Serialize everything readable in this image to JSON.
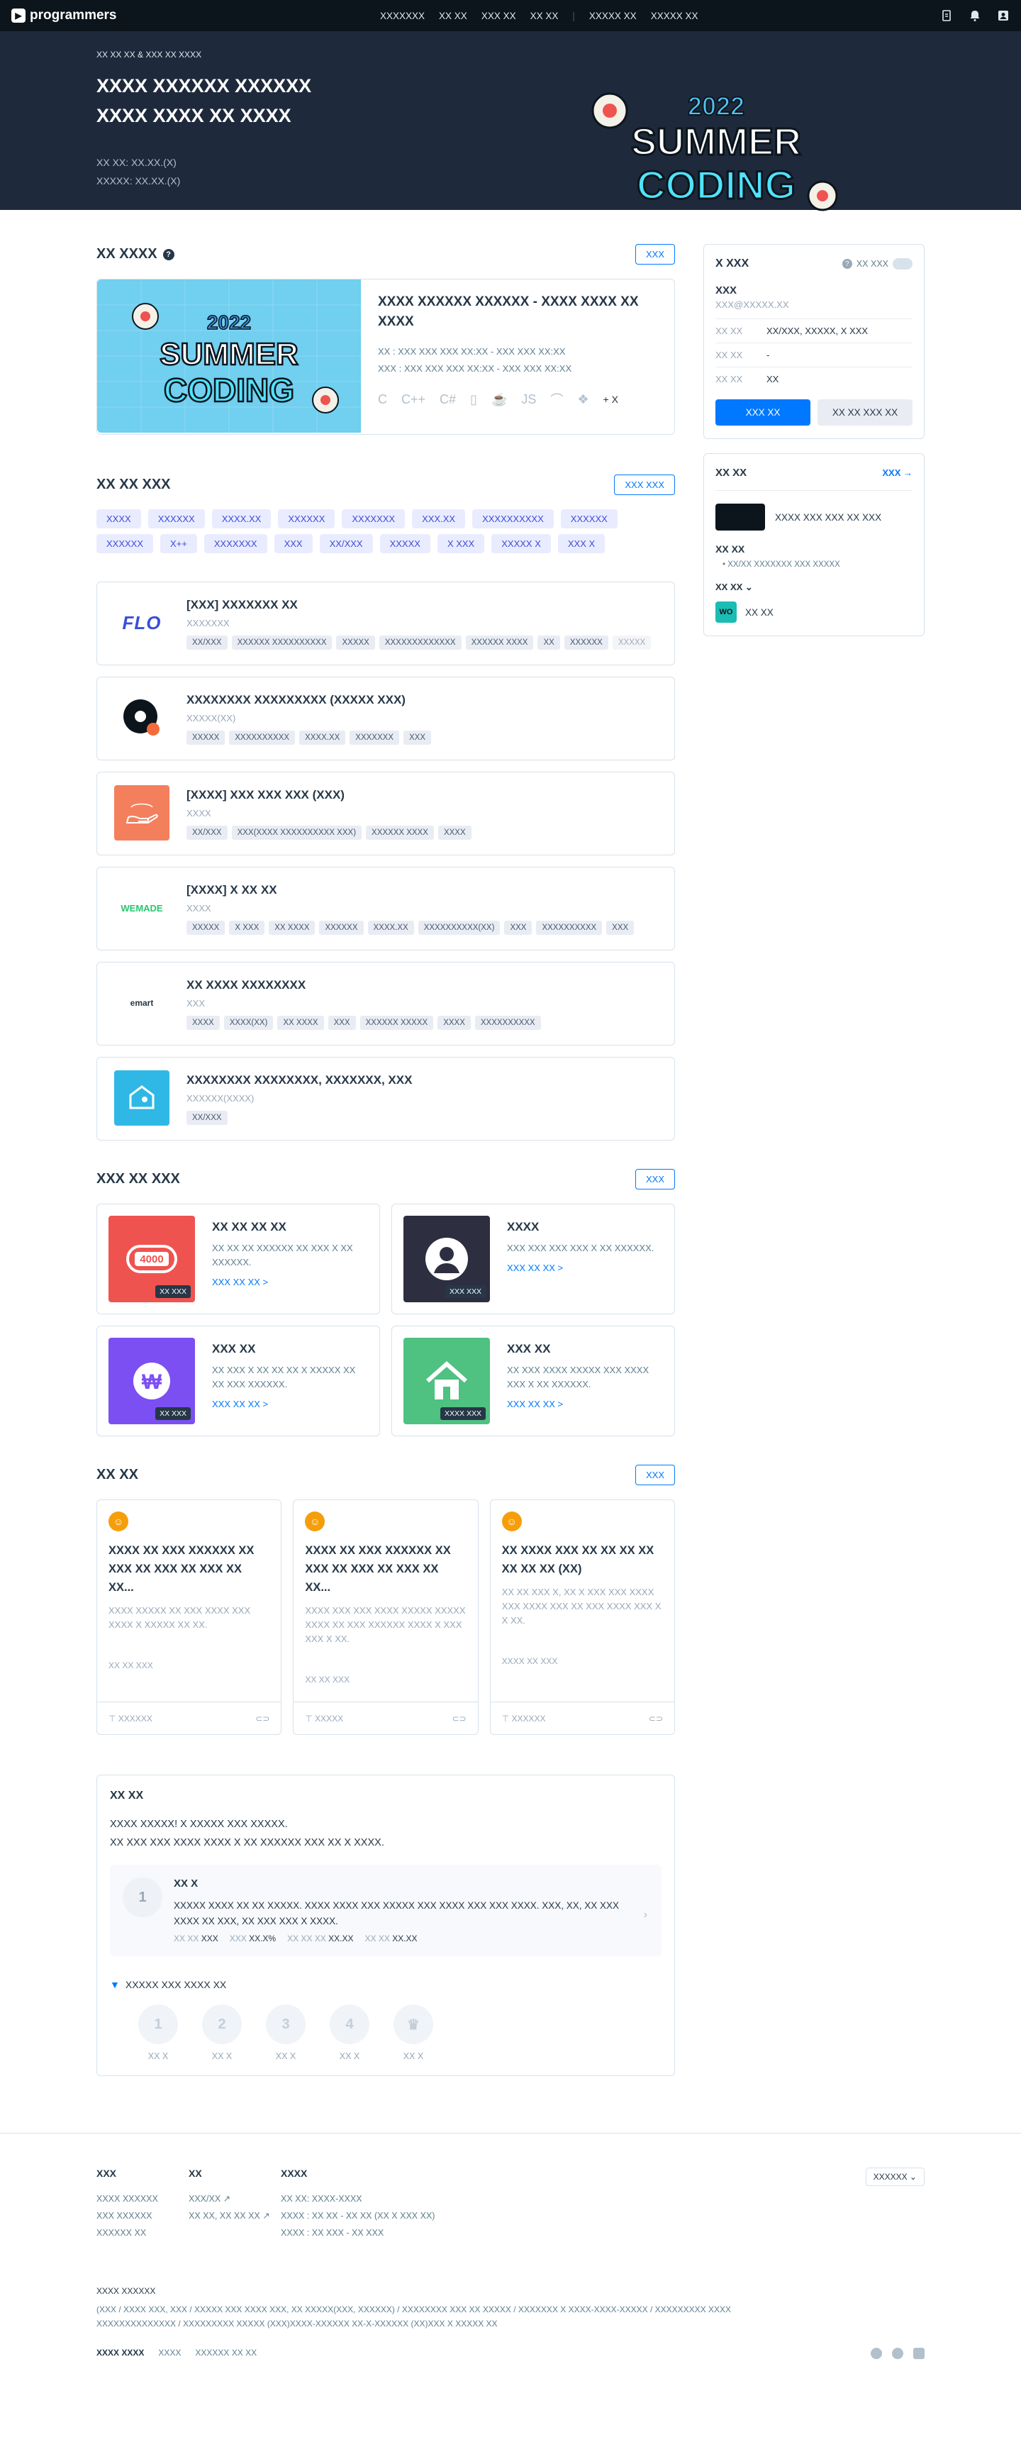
{
  "nav": {
    "brand": "programmers",
    "links": [
      "XXXXXXX",
      "XX XX",
      "XXX XX",
      "XX XX",
      "XXXXX XX",
      "XXXXX XX"
    ]
  },
  "hero": {
    "crumb": "XX XX XX & XXX XX XXXX",
    "title_line1": "XXXX XXXXXX XXXXXX",
    "title_line2": "XXXX XXXX XX XXXX",
    "meta_line1": "XX XX: XX.XX.(X)",
    "meta_line2": "XXXXX: XX.XX.(X)",
    "art_year": "2022",
    "art_word1": "SUMMER",
    "art_word2": "CODING"
  },
  "featured": {
    "section_title": "XX XXXX",
    "all_button": "XXX",
    "title": "XXXX XXXXXX XXXXXX - XXXX XXXX XX XXXX",
    "line1": "XX : XXX XXX XXX XX:XX - XXX XXX XX:XX",
    "line2": "XXX : XXX XXX XXX XX:XX - XXX XXX XX:XX",
    "langs": [
      "C",
      "C++",
      "C#",
      "▯",
      "☕",
      "JS",
      "⌒",
      "❖"
    ],
    "langs_more": "+ X"
  },
  "jobs": {
    "section_title": "XX XX XXX",
    "all_button": "XXX XXX",
    "tags": [
      "XXXX",
      "XXXXXX",
      "XXXX.XX",
      "XXXXXX",
      "XXXXXXX",
      "XXX.XX",
      "XXXXXXXXXX",
      "XXXXXX",
      "XXXXXX",
      "X++",
      "XXXXXXX",
      "XXX",
      "XX/XXX",
      "XXXXX",
      "X XXX",
      "XXXXX X",
      "XXX X"
    ],
    "items": [
      {
        "logo_text": "FLO",
        "title": "[XXX] XXXXXXX XX",
        "sub": "XXXXXXX",
        "chips": [
          "XX/XXX",
          "XXXXXX XXXXXXXXXX",
          "XXXXX",
          "XXXXXXXXXXXXX",
          "XXXXXX XXXX",
          "XX",
          "XXXXXX",
          "XXXXX"
        ]
      },
      {
        "logo_text": "",
        "title": "XXXXXXXX XXXXXXXXX (XXXXX XXX)",
        "sub": "XXXXX(XX)",
        "chips": [
          "XXXXX",
          "XXXXXXXXXX",
          "XXXX.XX",
          "XXXXXXX",
          "XXX"
        ]
      },
      {
        "logo_text": "",
        "title": "[XXXX] XXX XXX XXX (XXX)",
        "sub": "XXXX",
        "chips": [
          "XX/XXX",
          "XXX(XXXX XXXXXXXXXX XXX)",
          "XXXXXX XXXX",
          "XXXX"
        ]
      },
      {
        "logo_text": "WEMADE",
        "title": "[XXXX] X XX XX",
        "sub": "XXXX",
        "chips": [
          "XXXXX",
          "X XXX",
          "XX XXXX",
          "XXXXXX",
          "XXXX.XX",
          "XXXXXXXXXX(XX)",
          "XXX",
          "XXXXXXXXXX",
          "XXX"
        ]
      },
      {
        "logo_text": "emart",
        "title": "XX XXXX XXXXXXXX",
        "sub": "XXX",
        "chips": [
          "XXXX",
          "XXXX(XX)",
          "XX XXXX",
          "XXX",
          "XXXXXX XXXXX",
          "XXXX",
          "XXXXXXXXXX"
        ]
      },
      {
        "logo_text": "",
        "title": "XXXXXXXX XXXXXXXX, XXXXXXX, XXX",
        "sub": "XXXXXX(XXXX)",
        "chips": [
          "XX/XXX"
        ]
      }
    ]
  },
  "services": {
    "section_title": "XXX XX XXX",
    "all_button": "XXX",
    "items": [
      {
        "title": "XX XX XX XX",
        "desc": "XX XX XX XXXXXX XX XXX X XX XXXXXX.",
        "more": "XXX XX XX >",
        "badge": "XX XXX",
        "icon_text": "4000",
        "color": "#ef5350"
      },
      {
        "title": "XXXX",
        "desc": "XXX XXX XXX XXX X XX XXXXXX.",
        "more": "XXX XX XX >",
        "badge": "XXX XXX",
        "icon_text": "",
        "color": "#2d2f40"
      },
      {
        "title": "XXX XX",
        "desc": "XX XXX X XX XX XX X XXXXX XX XX XXX XXXXXX.",
        "more": "XXX XX XX >",
        "badge": "XX XXX",
        "icon_text": "₩",
        "color": "#7b4ff2"
      },
      {
        "title": "XXX XX",
        "desc": "XX XXX XXXX XXXXX XXX XXXX XXX X XX XXXXXX.",
        "more": "XXX XX XX >",
        "badge": "XXXX XXX",
        "icon_text": "",
        "color": "#4fc181"
      }
    ]
  },
  "news": {
    "section_title": "XX XX",
    "all_button": "XXX",
    "items": [
      {
        "title": "XXXX XX XXX XXXXXX XX XXX XX XXX XX XXX XX XX...",
        "desc": "XXXX XXXXX XX XXX XXXX XXX XXXX X XXXXX XX XX.",
        "foot": "XX   XX XXX",
        "author": "XXXXXX"
      },
      {
        "title": "XXXX XX XXX XXXXXX XX XXX XX XXX XX XXX XX XX...",
        "desc": "XXXX XXX XXX XXXX XXXXX XXXXX XXXX XX XXX XXXXXX XXXX X XXX XXX X XX.",
        "foot": "XX   XX XXX",
        "author": "XXXXX"
      },
      {
        "title": "XX XXXX XXX XX XX XX XX XX XX XX (XX)",
        "desc": "XX XX XXX X, XX X XXX XXX XXXX XXX XXXX XXX XX XXX XXXX XXX X X XX.",
        "foot": "XXXX   XX XXX",
        "author": "XXXXXX"
      }
    ]
  },
  "level": {
    "title": "XX XX",
    "intro_line1": "XXXX XXXXX! X XXXXX XXX XXXXX.",
    "intro_line2": "XX XXX XXX XXXX XXXX X XX XXXXXX XXX XX X XXXX.",
    "box_title": "XX X",
    "box_text": "XXXXX XXXX XX XX XXXXX. XXXX XXXX XXX XXXXX XXX XXXX XXX XXX XXXX. XXX, XX, XX XXX XXXX XX XXX, XX XXX XXX X XXXX.",
    "stat1_k": "XX XX",
    "stat1_v": "XXX",
    "stat2_k": "XXX",
    "stat2_v": "XX.X%",
    "stat3_k": "XX XX XX",
    "stat3_v": "XX.XX",
    "stat4_k": "XX XX",
    "stat4_v": "XX.XX",
    "box_icon": "1",
    "sub_title": "XXXXX XXX XXXX XX",
    "levels": [
      {
        "num": "1",
        "label": "XX X"
      },
      {
        "num": "2",
        "label": "XX X"
      },
      {
        "num": "3",
        "label": "XX X"
      },
      {
        "num": "4",
        "label": "XX X"
      },
      {
        "num": "♛",
        "label": "XX X"
      }
    ]
  },
  "side": {
    "account_title": "X XXX",
    "toggle_label": "XX XXX",
    "name": "XXX",
    "email": "XXX@XXXXX.XX",
    "rows": [
      {
        "k": "XX XX",
        "v": "XX/XXX, XXXXX, X XXX"
      },
      {
        "k": "XX XX",
        "v": "-"
      },
      {
        "k": "XX XX",
        "v": "XX"
      }
    ],
    "btn_primary": "XXX XX",
    "btn_secondary": "XX XX XXX XX",
    "events_title": "XX XX",
    "events_more": "XXX →",
    "event_item": "XXXX XXX XXX XX XXX",
    "notice_label": "XX XX",
    "notice_item": "XX/XX  XXXXXXX XXX XXXXX",
    "more_label": "XX XX ⌄",
    "wi_logo": "WO",
    "wi_text": "XX XX"
  },
  "footer": {
    "col1_title": "XXX",
    "col1_items": [
      "XXXX XXXXXX",
      "XXX XXXXXX",
      "XXXXXX XX"
    ],
    "col2_title": "XX",
    "col2_items": [
      "XXX/XX ↗",
      "XX XX, XX XX XX ↗"
    ],
    "col3_title": "XXXX",
    "col3_items": [
      "XX XX: XXXX-XXXX",
      "XXXX : XX XX - XX XX (XX X XXX XX)",
      "XXXX : XX XXX - XX XXX"
    ],
    "lang": "XXXXXX ⌄",
    "info_title": "XXXX XXXXXX",
    "info_line1": "(XXX / XXXX XXX, XXX / XXXXX XXX XXXX XXX, XX XXXXX(XXX, XXXXXX) / XXXXXXXX XXX XX XXXXX / XXXXXXX X XXXX-XXXX-XXXXX / XXXXXXXXX XXXX",
    "info_line2": "XXXXXXXXXXXXXX / XXXXXXXXX XXXXX (XXX)XXXX-XXXXXX XX-X-XXXXXX (XX)XXX X XXXXX XX",
    "link1": "XXXX XXXX",
    "link2": "XXXX",
    "link3": "XXXXXX XX XX"
  },
  "colors": {
    "accent": "#0078ff",
    "tag_bg": "#e9ecff",
    "hero_bg": "#1e2a3b"
  }
}
